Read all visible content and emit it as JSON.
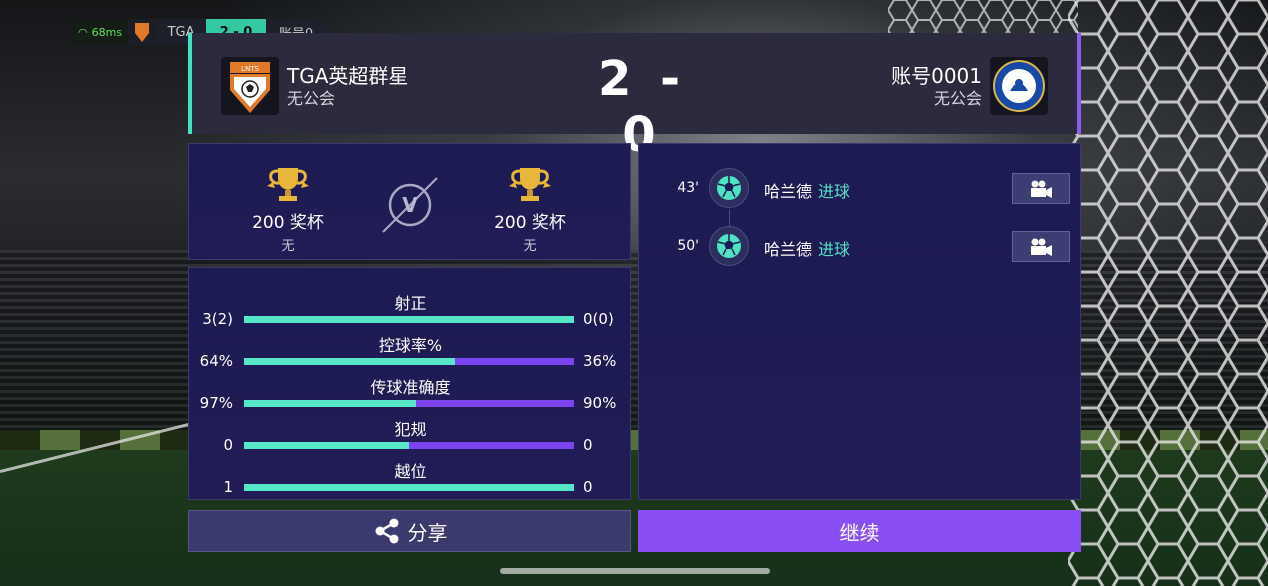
{
  "status_strip": {
    "ping": "68ms",
    "team_short": "TGA",
    "score": "2 - 0",
    "opponent": "账号0"
  },
  "match": {
    "home": {
      "name": "TGA英超群星",
      "club": "无公会"
    },
    "away": {
      "name": "账号0001",
      "club": "无公会"
    },
    "score": "2 - 0"
  },
  "trophies": {
    "home": {
      "count": "200 奖杯",
      "sub": "无"
    },
    "away": {
      "count": "200 奖杯",
      "sub": "无"
    },
    "vs": "V"
  },
  "stats": [
    {
      "title": "射正",
      "home": "3(2)",
      "away": "0(0)",
      "home_fraction": 1.0
    },
    {
      "title": "控球率%",
      "home": "64%",
      "away": "36%",
      "home_fraction": 0.64
    },
    {
      "title": "传球准确度",
      "home": "97%",
      "away": "90%",
      "home_fraction": 0.52
    },
    {
      "title": "犯规",
      "home": "0",
      "away": "0",
      "home_fraction": 0.5
    },
    {
      "title": "越位",
      "home": "1",
      "away": "0",
      "home_fraction": 1.0
    }
  ],
  "events": [
    {
      "minute": "43'",
      "player": "哈兰德",
      "type": "进球"
    },
    {
      "minute": "50'",
      "player": "哈兰德",
      "type": "进球"
    }
  ],
  "buttons": {
    "share": "分享",
    "continue": "继续"
  },
  "colors": {
    "accent_home": "#56e7c9",
    "accent_away": "#7c44f0",
    "continue_button": "#8a4ff4"
  }
}
